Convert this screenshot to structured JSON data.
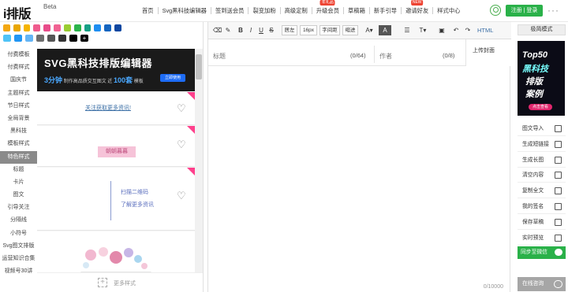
{
  "brand": {
    "logo": "i排版",
    "beta": "Beta"
  },
  "nav": {
    "items": [
      {
        "label": "首页"
      },
      {
        "label": "Svg黑科技编辑器"
      },
      {
        "label": "签到送会员"
      },
      {
        "label": "裂变加粉"
      },
      {
        "label": "高级定制"
      },
      {
        "label": "升级会员",
        "badge": "年礼品"
      },
      {
        "label": "草稿箱"
      },
      {
        "label": "新手引导"
      },
      {
        "label": "邀请好友",
        "badge": "NEW"
      },
      {
        "label": "样式中心"
      }
    ],
    "login_label": "注册 | 登录"
  },
  "colors": {
    "brand_green": "#2ab149",
    "swatches_row1": [
      "#f3a712",
      "#e9a600",
      "#f5b400",
      "#ef5b8d",
      "#e84c8a",
      "#f06292",
      "#9acd32",
      "#2bb44b",
      "#16a085",
      "#1f8ef1",
      "#1565c0",
      "#0d47a1"
    ],
    "swatches_row2": [
      "#4fc3f7",
      "#2196f3",
      "#64b5f6",
      "#6d6d6d",
      "#555555",
      "#333333",
      "#000000"
    ]
  },
  "sidebar": {
    "items": [
      {
        "label": "付费模板"
      },
      {
        "label": "付费样式"
      },
      {
        "label": "国庆节"
      },
      {
        "label": "主题样式"
      },
      {
        "label": "节日样式"
      },
      {
        "label": "全局背景"
      },
      {
        "label": "黑科技"
      },
      {
        "label": "模板样式"
      },
      {
        "label": "特色样式",
        "active": true
      },
      {
        "label": "标题"
      },
      {
        "label": "卡片"
      },
      {
        "label": "图文"
      },
      {
        "label": "引导关注"
      },
      {
        "label": "分隔线"
      },
      {
        "label": "小符号"
      },
      {
        "label": "Svg图文排版"
      },
      {
        "label": "运营知识合集"
      },
      {
        "label": "视频号30讲"
      }
    ]
  },
  "content": {
    "banner_title": "SVG黑科技排版编辑器",
    "banner_sub_a": "3分钟",
    "banner_sub_b": "制作高品质交互图文  近",
    "banner_sub_c": "100套",
    "banner_sub_d": "模板",
    "banner_btn": "立即使用",
    "follow_text": "关注获取更多资讯!",
    "tag_text": "朝朝暮暮",
    "qr_line1": "扫描二维码",
    "qr_line2": "了解更多资讯",
    "add_more": "更多样式"
  },
  "editor": {
    "toolbar": {
      "indent_left": "居左",
      "font_size": "16px",
      "letter_spacing": "字间距",
      "indent": "缩进",
      "html": "HTML"
    },
    "title_placeholder": "标题",
    "title_count": "(0/64)",
    "author_placeholder": "作者",
    "author_count": "(0/8)",
    "cover": "上传封面",
    "char_count": "0/10000"
  },
  "right": {
    "mode": "极简模式",
    "ad": {
      "line1": "Top50",
      "line2": "黑科技",
      "line3": "排版",
      "line4": "案例",
      "btn": "点击查看"
    },
    "actions": [
      {
        "label": "图文导入"
      },
      {
        "label": "生成短链接"
      },
      {
        "label": "生成长图"
      },
      {
        "label": "清空内容"
      },
      {
        "label": "复制全文"
      },
      {
        "label": "我的签名"
      },
      {
        "label": "保存草稿"
      },
      {
        "label": "实时预览"
      }
    ],
    "sync": "同步至微信",
    "consult": "在线咨询"
  }
}
